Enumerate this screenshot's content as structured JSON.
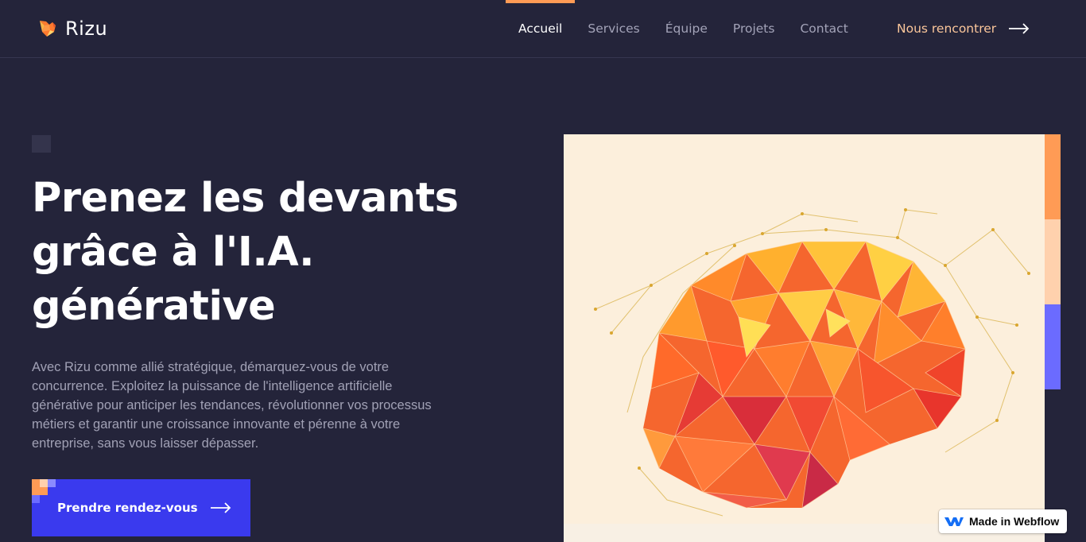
{
  "brand": {
    "name": "Rizu",
    "logo_icon": "fox-icon"
  },
  "nav": {
    "items": [
      {
        "label": "Accueil",
        "active": true
      },
      {
        "label": "Services",
        "active": false
      },
      {
        "label": "Équipe",
        "active": false
      },
      {
        "label": "Projets",
        "active": false
      },
      {
        "label": "Contact",
        "active": false
      }
    ],
    "cta_label": "Nous rencontrer",
    "cta_icon": "arrow-right-icon"
  },
  "hero": {
    "title_lines": [
      "Prenez les devants",
      "grâce à l'I.A.",
      "générative"
    ],
    "description": "Avec Rizu comme allié stratégique, démarquez-vous de votre concurrence. Exploitez la puissance de l'intelligence artificielle générative pour anticiper les tendances, révolutionner vos processus métiers et garantir une croissance innovante et pérenne à votre entreprise, sans vous laisser dépasser.",
    "button_label": "Prendre rendez-vous",
    "button_icon": "arrow-right-icon",
    "image": "low-poly-brain-illustration"
  },
  "webflow_badge": {
    "label": "Made in Webflow",
    "icon": "webflow-logo-icon"
  },
  "colors": {
    "background": "#24243a",
    "accent_orange": "#ff9b55",
    "accent_peach": "#ffd1ad",
    "accent_blue": "#3a3aee",
    "accent_periwinkle": "#6b6bff",
    "nav_cta": "#fcc79b",
    "image_bg": "#fcefdc"
  }
}
